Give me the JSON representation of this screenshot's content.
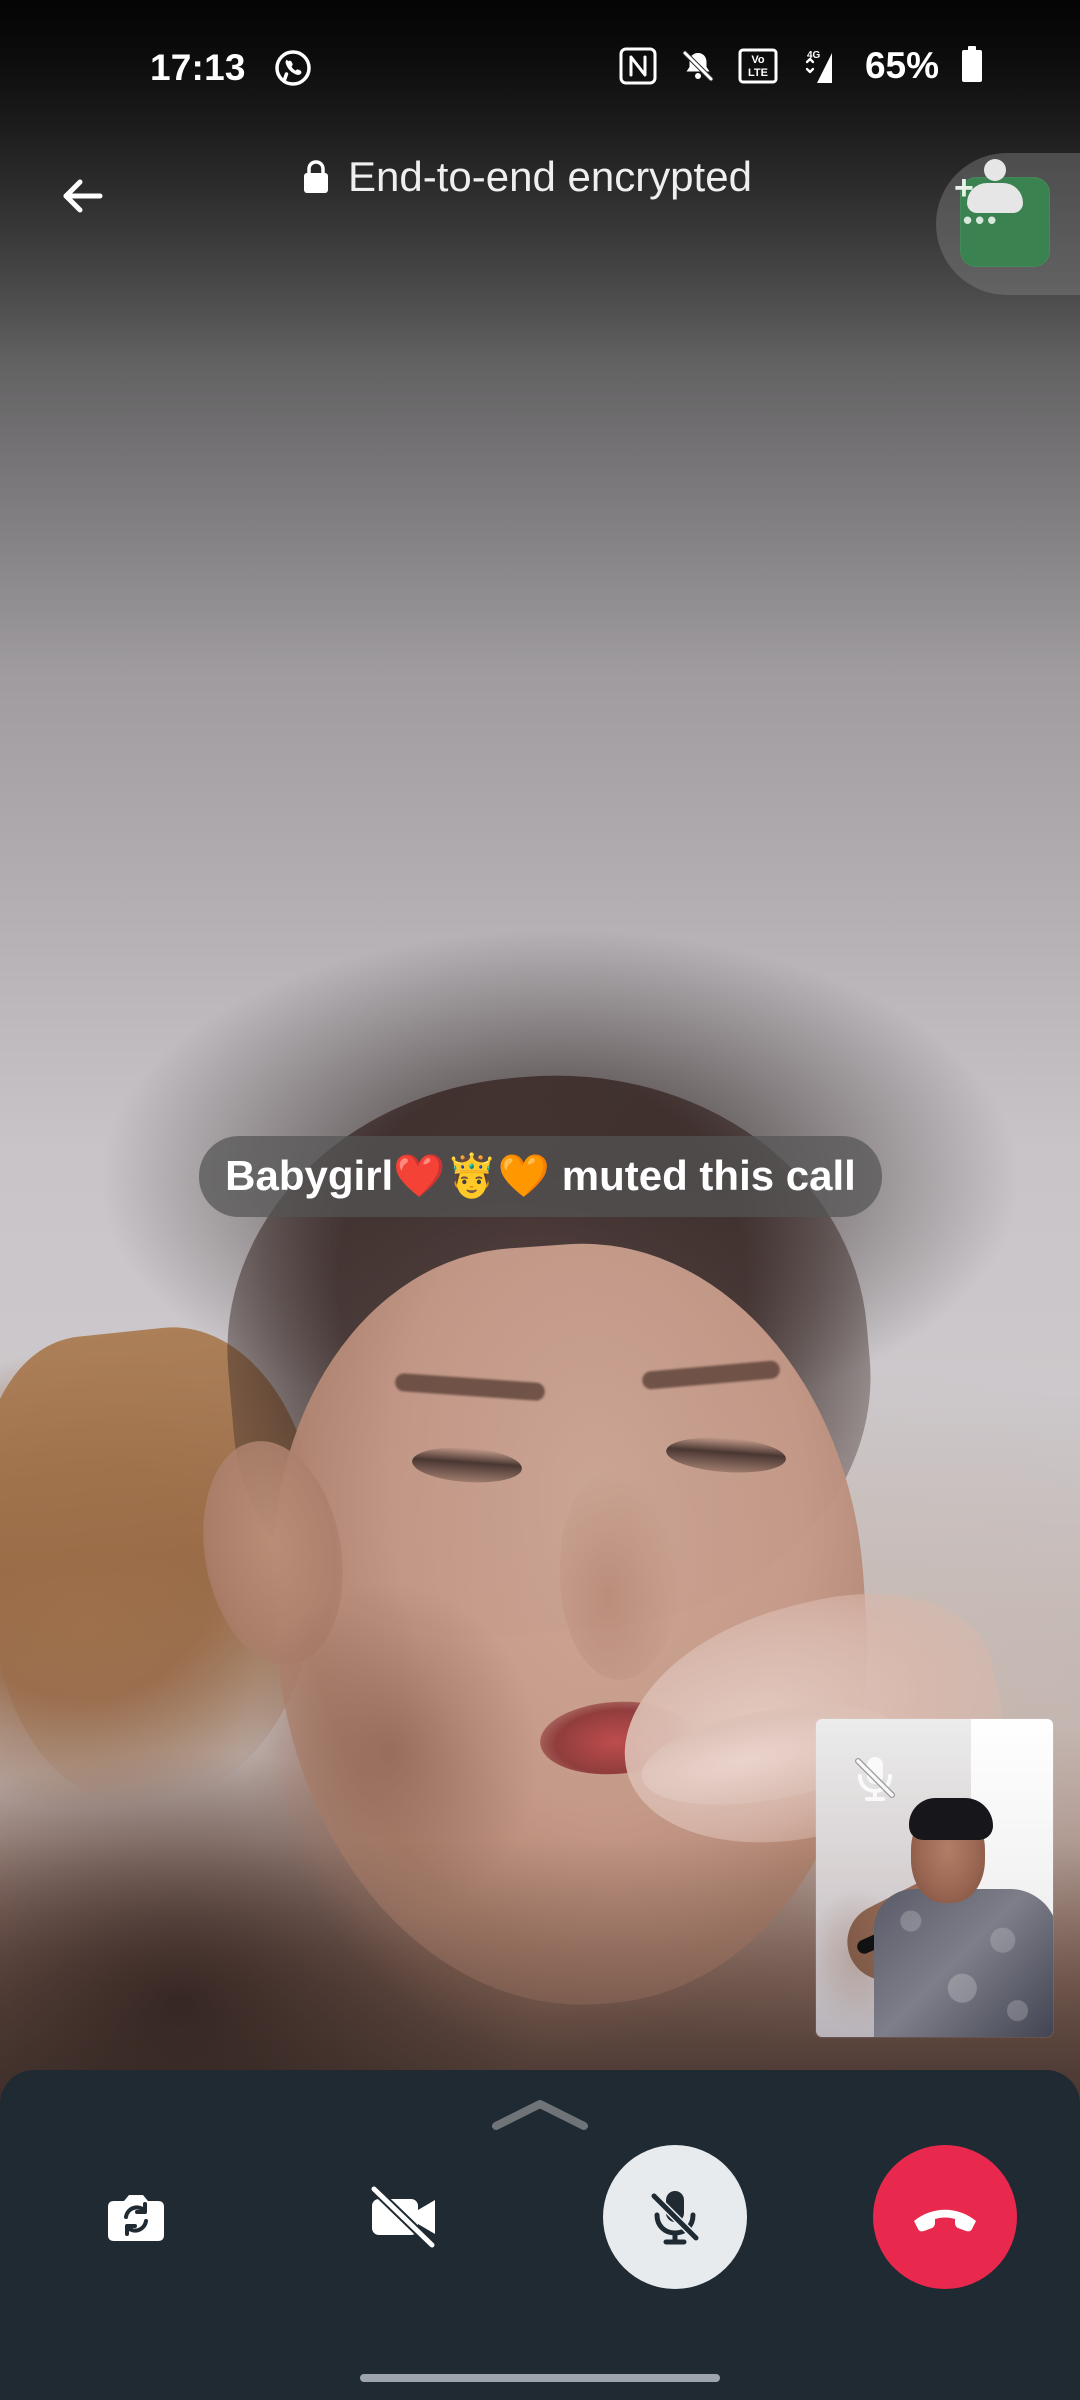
{
  "status_bar": {
    "time": "17:13",
    "battery": "65%",
    "icons": [
      "whatsapp-icon",
      "nfc-icon",
      "bell-off-icon",
      "volte-icon",
      "signal-icon",
      "battery-icon"
    ]
  },
  "header": {
    "encryption_label": "End-to-end encrypted",
    "back_icon": "arrow-left-icon",
    "lock_icon": "lock-icon",
    "participant_icon": "add-participant-icon"
  },
  "call": {
    "notice": "Babygirl❤️🤴🧡 muted this call"
  },
  "controls": {
    "flip_icon": "camera-flip-icon",
    "video_icon": "video-off-icon",
    "mute_icon": "microphone-off-icon",
    "end_icon": "phone-end-icon",
    "drawer_icon": "chevron-up-icon"
  },
  "colors": {
    "panel": "#1f2a33",
    "end_call": "#e9284e",
    "participant_card": "#3b8251"
  }
}
